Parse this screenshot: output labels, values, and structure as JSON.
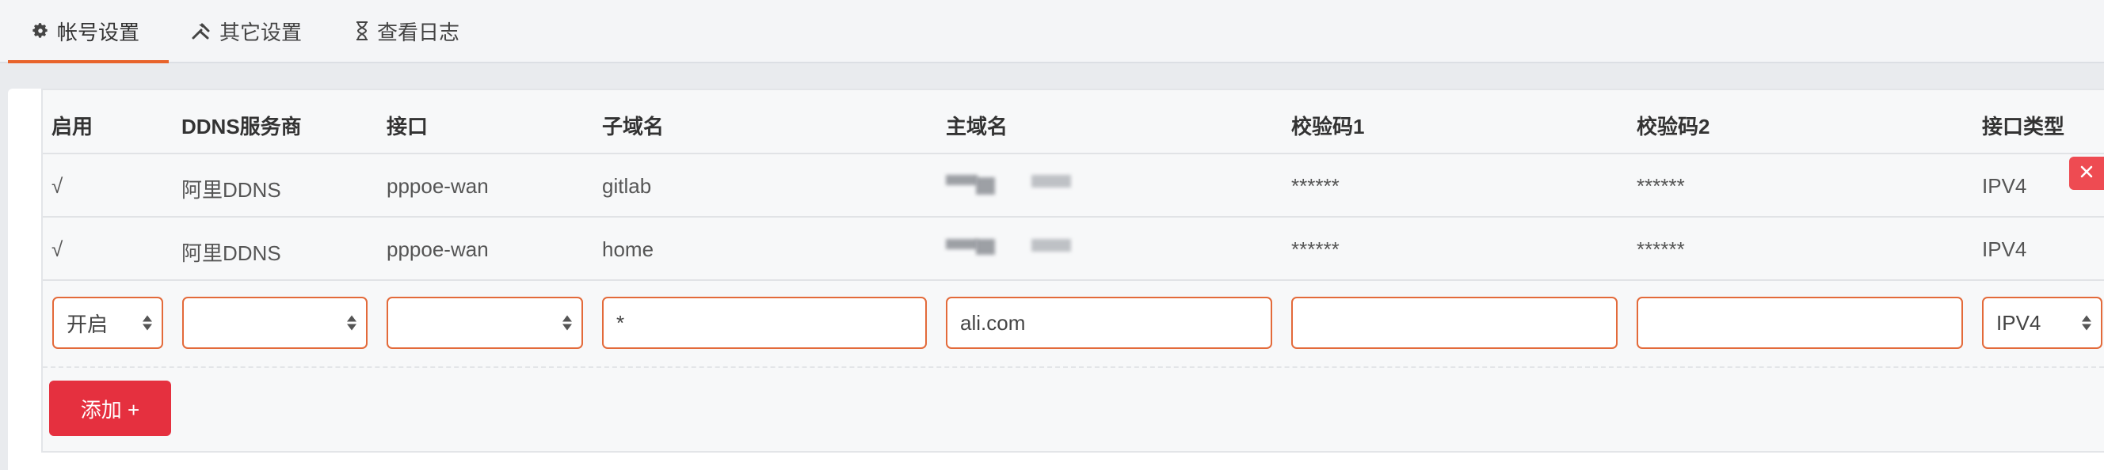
{
  "tabs": [
    {
      "label": "帐号设置",
      "icon": "gear-icon"
    },
    {
      "label": "其它设置",
      "icon": "tools-icon"
    },
    {
      "label": "查看日志",
      "icon": "hourglass-icon"
    }
  ],
  "table": {
    "headers": [
      "启用",
      "DDNS服务商",
      "接口",
      "子域名",
      "主域名",
      "校验码1",
      "校验码2",
      "接口类型"
    ],
    "rows": [
      {
        "enabled": "√",
        "provider": "阿里DDNS",
        "interface": "pppoe-wan",
        "subdomain": "gitlab",
        "key1": "******",
        "key2": "******",
        "type": "IPV4"
      },
      {
        "enabled": "√",
        "provider": "阿里DDNS",
        "interface": "pppoe-wan",
        "subdomain": "home",
        "key1": "******",
        "key2": "******",
        "type": "IPV4"
      }
    ]
  },
  "form": {
    "enabled_value": "开启",
    "provider_value": "",
    "interface_value": "",
    "subdomain_value": "*",
    "domain_value": "ali.com",
    "key1_value": "",
    "key2_value": "",
    "type_value": "IPV4"
  },
  "buttons": {
    "add_label": "添加 +",
    "delete_icon": "close-icon"
  },
  "colors": {
    "accent": "#e8632b",
    "danger": "#e5303f",
    "input_border": "#e36a3a"
  }
}
